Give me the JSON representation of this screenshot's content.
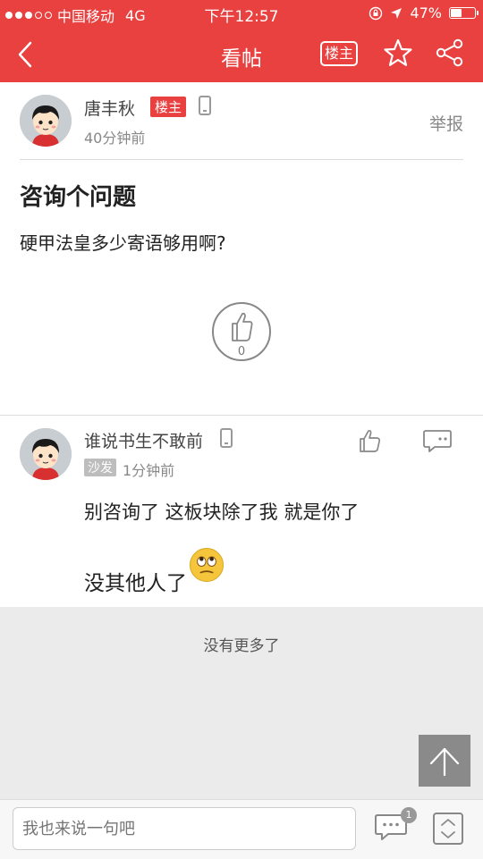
{
  "status_bar": {
    "carrier": "中国移动",
    "network": "4G",
    "time": "下午12:57",
    "battery": "47%",
    "battery_level": 0.47
  },
  "nav": {
    "title": "看帖",
    "owner_button": "楼主"
  },
  "post": {
    "author": "唐丰秋",
    "owner_badge": "楼主",
    "time": "40分钟前",
    "report": "举报",
    "title": "咨询个问题",
    "body": "硬甲法皇多少寄语够用啊?",
    "likes": "0"
  },
  "reply": {
    "author": "谁说书生不敢前",
    "floor_badge": "沙发",
    "time": "1分钟前",
    "text_line1": "别咨询了 这板块除了我 就是你了",
    "text_line2": "没其他人了"
  },
  "footer": {
    "no_more": "没有更多了"
  },
  "bottom_bar": {
    "input_placeholder": "我也来说一句吧",
    "comment_count": "1"
  },
  "colors": {
    "accent": "#e94040"
  }
}
